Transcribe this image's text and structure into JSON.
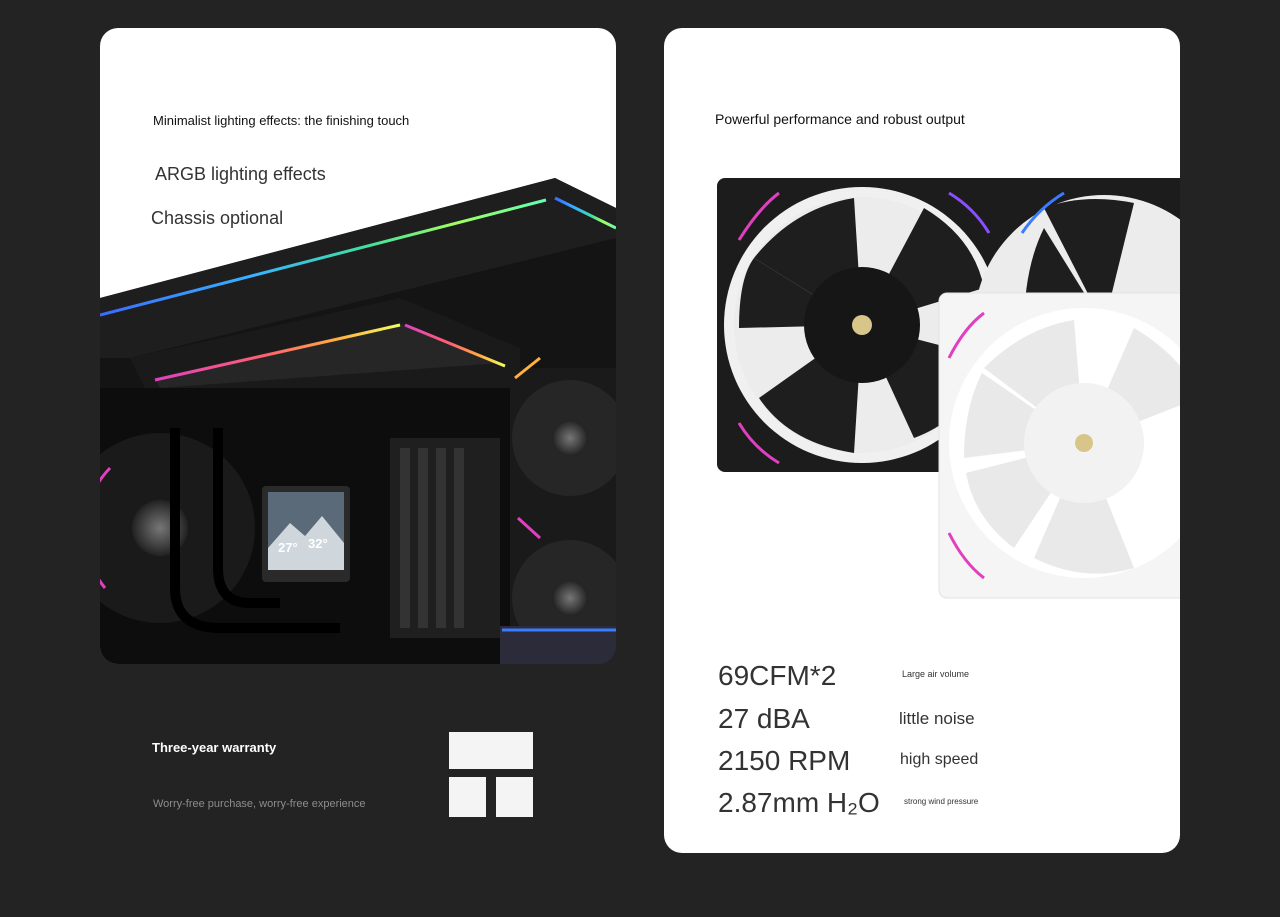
{
  "left_card": {
    "subtitle": "Minimalist lighting effects: the finishing touch",
    "features": [
      "ARGB lighting effects",
      "Chassis optional"
    ],
    "display": {
      "temp_1": "27°",
      "temp_2": "32°"
    }
  },
  "right_card": {
    "subtitle": "Powerful performance and robust output",
    "specs": [
      {
        "value": "69CFM*2",
        "label": "Large air volume"
      },
      {
        "value": "27 dBA",
        "label": "little noise"
      },
      {
        "value": "2150 RPM",
        "label": "high speed"
      },
      {
        "value": "2.87mm H₂O",
        "label": "strong wind pressure"
      }
    ]
  },
  "warranty": {
    "title": "Three-year warranty",
    "description": "Worry-free purchase, worry-free experience",
    "logo_icon": "brand-logo-icon"
  },
  "colors": {
    "background": "#232323",
    "card": "#ffffff",
    "accent_magenta": "#e040c0",
    "accent_blue": "#3a7bff"
  }
}
